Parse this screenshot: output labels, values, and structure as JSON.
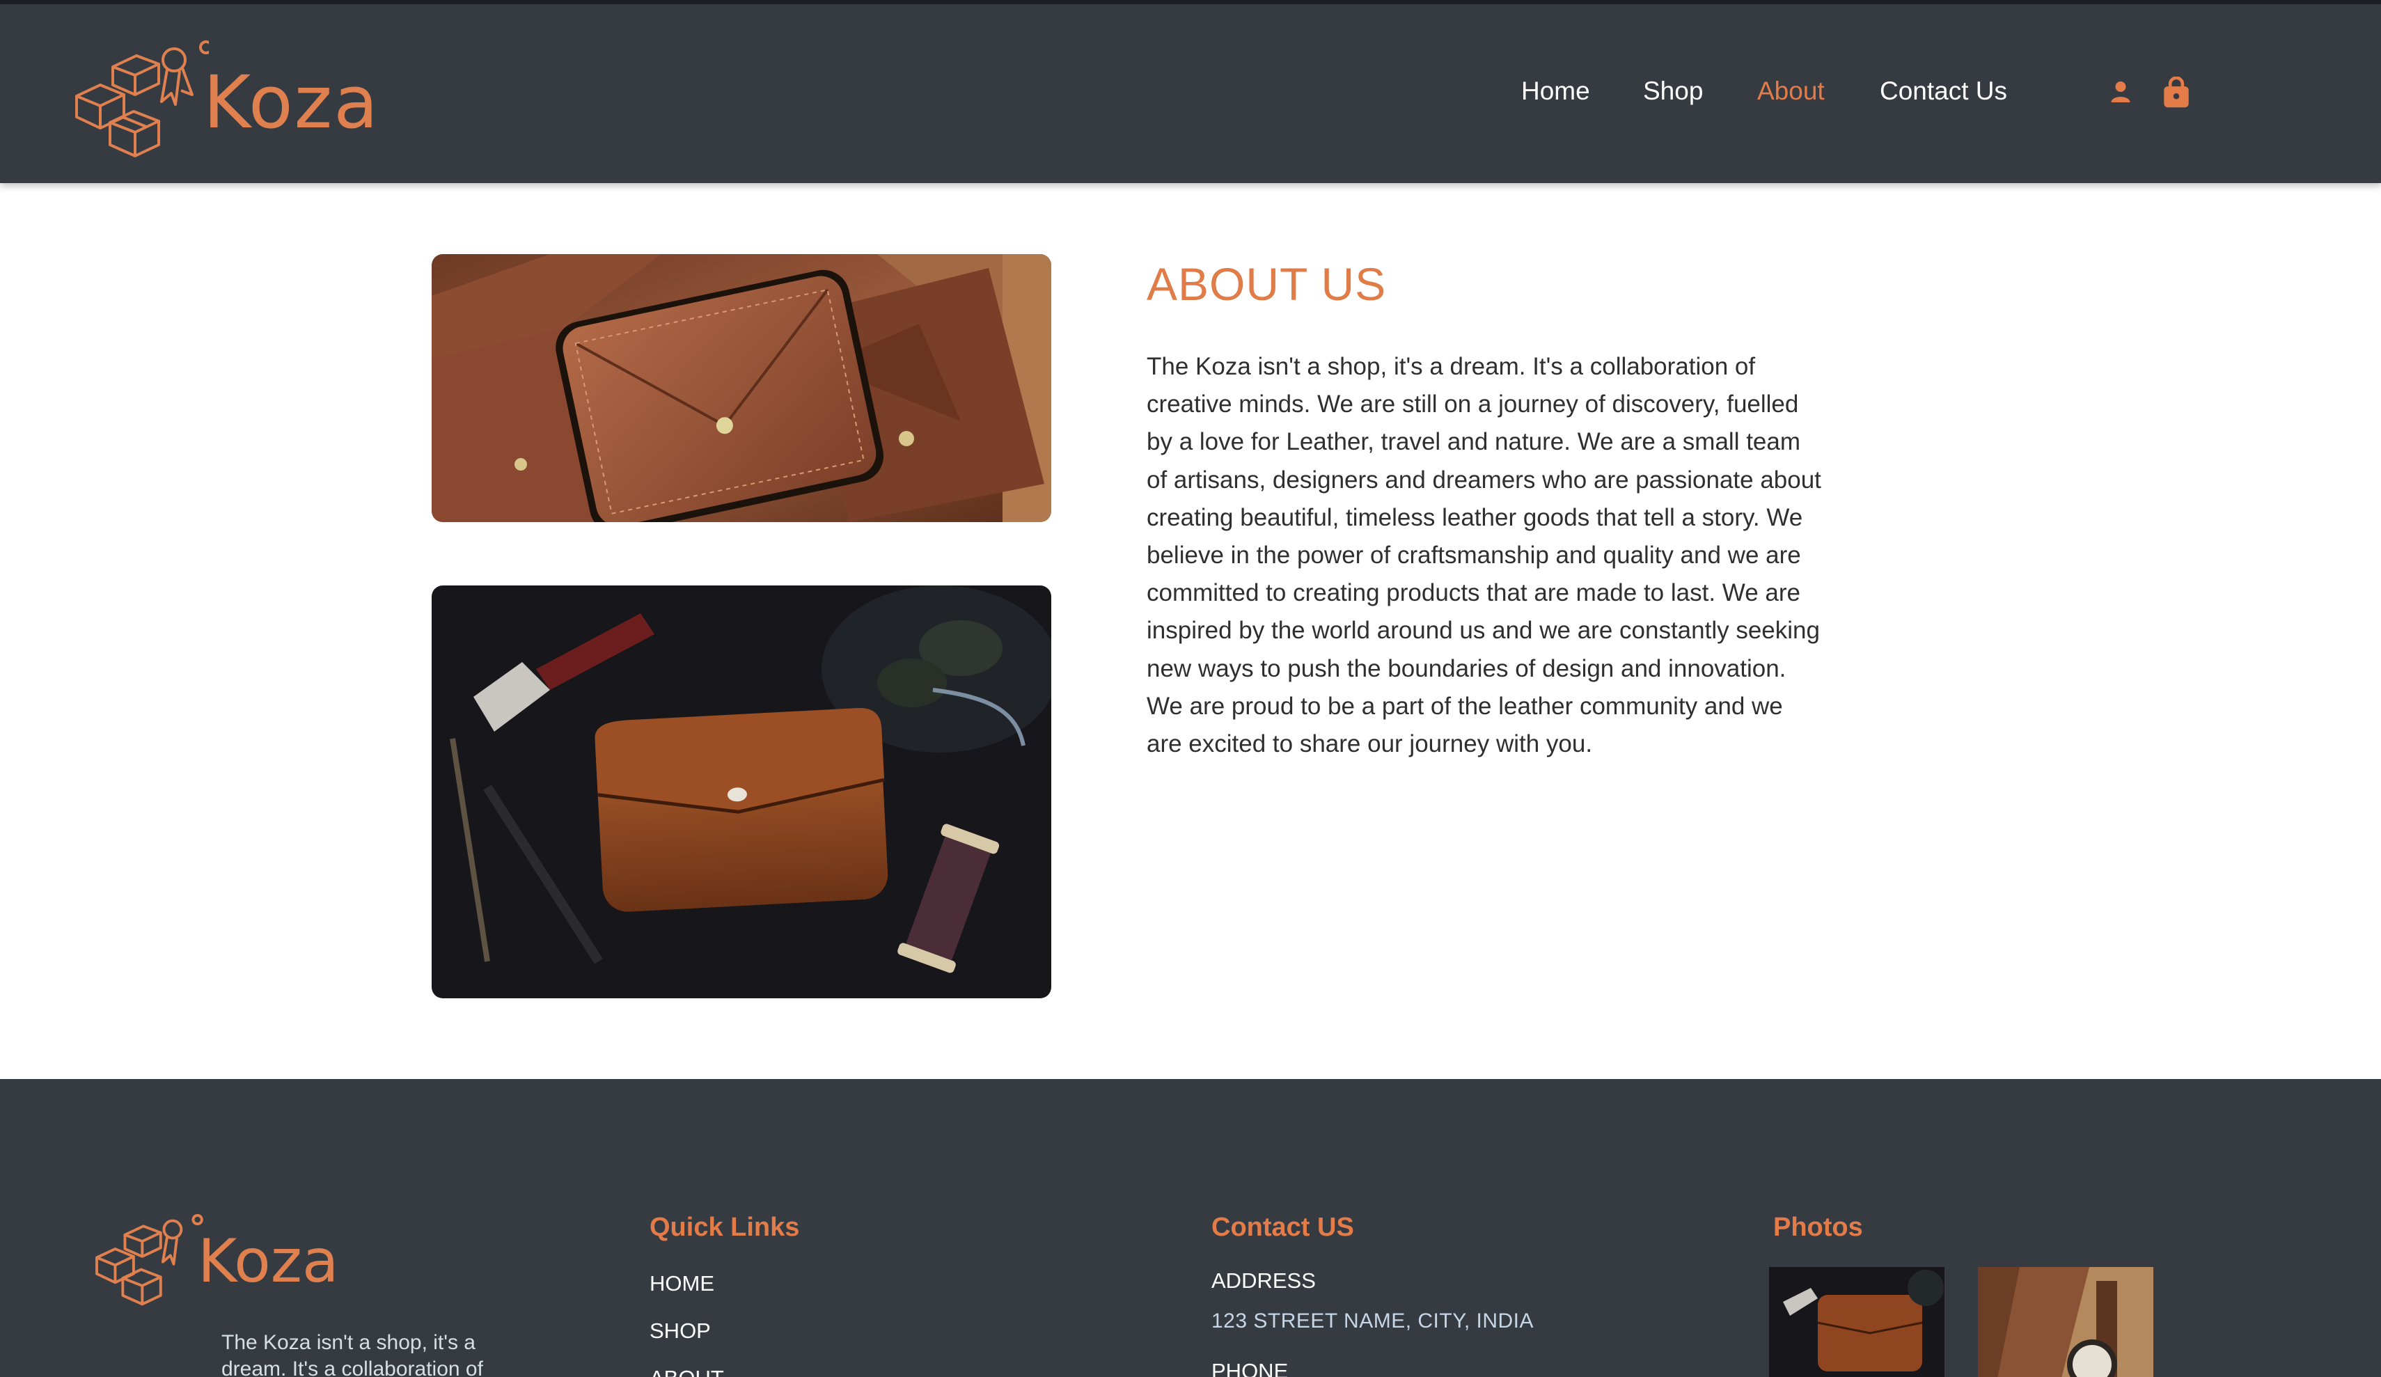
{
  "header": {
    "brand": "Koza",
    "nav": [
      {
        "label": "Home",
        "active": false
      },
      {
        "label": "Shop",
        "active": false
      },
      {
        "label": "About",
        "active": true
      },
      {
        "label": "Contact Us",
        "active": false
      }
    ],
    "icons": [
      "user-icon",
      "shopping-bag-icon"
    ]
  },
  "main": {
    "title": "ABOUT US",
    "body": "The Koza isn't a shop, it's a dream. It's a collaboration of creative minds. We are still on a journey of discovery, fuelled by a love for Leather, travel and nature. We are a small team of artisans, designers and dreamers who are passionate about creating beautiful, timeless leather goods that tell a story. We believe in the power of craftsmanship and quality and we are committed to creating products that are made to last. We are inspired by the world around us and we are constantly seeking new ways to push the boundaries of design and innovation. We are proud to be a part of the leather community and we are excited to share our journey with you."
  },
  "footer": {
    "brand": "Koza",
    "about_snippet": "The Koza isn't a shop, it's a dream. It's a collaboration of",
    "quick_links_title": "Quick Links",
    "quick_links": [
      "HOME",
      "SHOP",
      "ABOUT"
    ],
    "contact_title": "Contact US",
    "address_label": "ADDRESS",
    "address_value": "123 STREET NAME, CITY, INDIA",
    "phone_label": "PHONE",
    "photos_title": "Photos"
  },
  "colors": {
    "accent": "#e47c49",
    "header_bg": "#363b42",
    "footer_bg": "#363b42",
    "text": "#2f2f2f"
  }
}
